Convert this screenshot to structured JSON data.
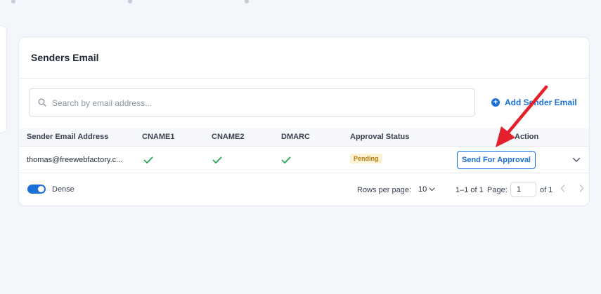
{
  "card": {
    "title": "Senders Email"
  },
  "search": {
    "placeholder": "Search by email address..."
  },
  "add_sender": {
    "label": "Add Sender Email"
  },
  "table": {
    "columns": [
      "Sender Email Address",
      "CNAME1",
      "CNAME2",
      "DMARC",
      "Approval Status",
      "Action"
    ],
    "rows": [
      {
        "email": "thomas@freewebfactory.c...",
        "cname1": "verified",
        "cname2": "verified",
        "dmarc": "verified",
        "status": "Pending",
        "action": "Send For Approval"
      }
    ]
  },
  "footer": {
    "dense_label": "Dense",
    "rows_per_page_label": "Rows per page:",
    "rows_per_page_value": "10",
    "range": "1–1 of 1",
    "page_label": "Page:",
    "page_value": "1",
    "page_total": "of 1"
  },
  "colors": {
    "accent": "#1a6fd8",
    "check": "#22a852",
    "pending_bg": "#fdf1d3",
    "pending_text": "#b07a0c",
    "arrow": "#e3202b"
  }
}
